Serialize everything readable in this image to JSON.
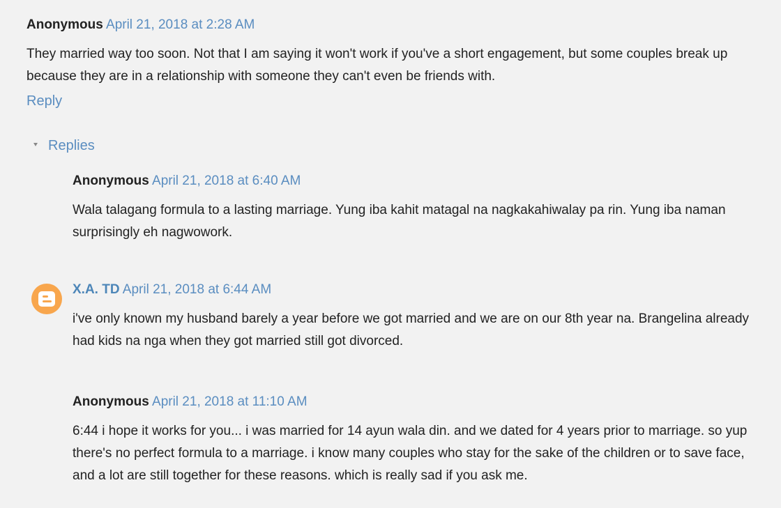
{
  "top_comment": {
    "author": "Anonymous",
    "timestamp": "April 21, 2018 at 2:28 AM",
    "body": "They married way too soon. Not that I am saying it won't work if you've a short engagement, but some couples break up because they are in a relationship with someone they can't even be friends with.",
    "reply_label": "Reply"
  },
  "replies_toggle": {
    "label": "Replies",
    "state": "expanded"
  },
  "replies": [
    {
      "author": "Anonymous",
      "timestamp": "April 21, 2018 at 6:40 AM",
      "body": "Wala talagang formula to a lasting marriage. Yung iba kahit matagal na nagkakahiwalay pa rin. Yung iba naman surprisingly eh nagwowork."
    },
    {
      "author": "X.A. TD",
      "avatar_icon": "blogger-icon",
      "timestamp": "April 21, 2018 at 6:44 AM",
      "body": "i've only known my husband barely a year before we got married and we are on our 8th year na. Brangelina already had kids na nga when they got married still got divorced."
    },
    {
      "author": "Anonymous",
      "timestamp": "April 21, 2018 at 11:10 AM",
      "body": "6:44 i hope it works for you... i was married for 14 ayun wala din. and we dated for 4 years prior to marriage. so yup there's no perfect formula to a marriage. i know many couples who stay for the sake of the children or to save face, and a lot are still together for these reasons. which is really sad if you ask me."
    }
  ],
  "colors": {
    "background": "#f2f2f2",
    "link": "#5a8dc0",
    "text": "#222222",
    "blogger_avatar": "#f8a64d"
  }
}
